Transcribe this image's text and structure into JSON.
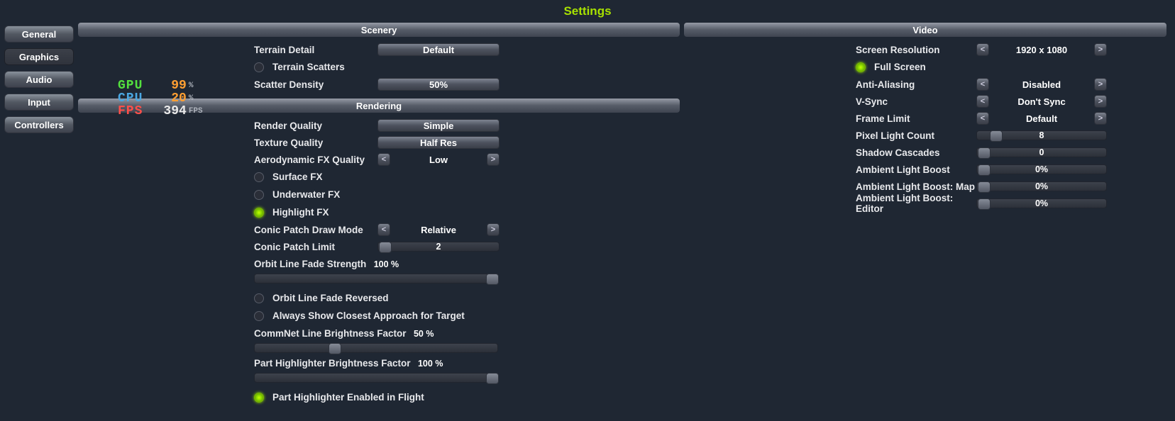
{
  "title": "Settings",
  "nav": {
    "general": "General",
    "graphics": "Graphics",
    "audio": "Audio",
    "input": "Input",
    "controllers": "Controllers"
  },
  "perf": {
    "gpu_label": "GPU",
    "gpu_value": "99",
    "gpu_unit": "%",
    "cpu_label": "CPU",
    "cpu_value": "20",
    "cpu_unit": "%",
    "fps_label": "FPS",
    "fps_value": "394",
    "fps_unit": "FPS"
  },
  "scenery": {
    "header": "Scenery",
    "terrain_detail_label": "Terrain Detail",
    "terrain_detail_value": "Default",
    "terrain_scatters_label": "Terrain Scatters",
    "scatter_density_label": "Scatter Density",
    "scatter_density_value": "50%"
  },
  "rendering": {
    "header": "Rendering",
    "render_quality_label": "Render Quality",
    "render_quality_value": "Simple",
    "texture_quality_label": "Texture Quality",
    "texture_quality_value": "Half Res",
    "aero_fx_label": "Aerodynamic FX Quality",
    "aero_fx_value": "Low",
    "surface_fx_label": "Surface FX",
    "underwater_fx_label": "Underwater FX",
    "highlight_fx_label": "Highlight FX",
    "conic_draw_label": "Conic Patch Draw Mode",
    "conic_draw_value": "Relative",
    "conic_limit_label": "Conic Patch Limit",
    "conic_limit_value": "2",
    "orbit_fade_label": "Orbit Line Fade Strength",
    "orbit_fade_value": "100 %",
    "orbit_fade_reversed_label": "Orbit Line Fade Reversed",
    "always_show_closest_label": "Always Show Closest Approach for Target",
    "commnet_label": "CommNet Line Brightness Factor",
    "commnet_value": "50 %",
    "part_highlight_label": "Part Highlighter Brightness Factor",
    "part_highlight_value": "100 %",
    "part_highlight_flight_label": "Part Highlighter Enabled in Flight"
  },
  "video": {
    "header": "Video",
    "resolution_label": "Screen Resolution",
    "resolution_value": "1920 x 1080",
    "fullscreen_label": "Full Screen",
    "aa_label": "Anti-Aliasing",
    "aa_value": "Disabled",
    "vsync_label": "V-Sync",
    "vsync_value": "Don't Sync",
    "framelimit_label": "Frame Limit",
    "framelimit_value": "Default",
    "pixel_light_label": "Pixel Light Count",
    "pixel_light_value": "8",
    "shadow_cascades_label": "Shadow Cascades",
    "shadow_cascades_value": "0",
    "amb_boost_label": "Ambient Light Boost",
    "amb_boost_value": "0%",
    "amb_boost_map_label": "Ambient Light Boost: Map",
    "amb_boost_map_value": "0%",
    "amb_boost_editor_label": "Ambient Light Boost: Editor",
    "amb_boost_editor_value": "0%"
  },
  "glyphs": {
    "left": "<",
    "right": ">"
  }
}
